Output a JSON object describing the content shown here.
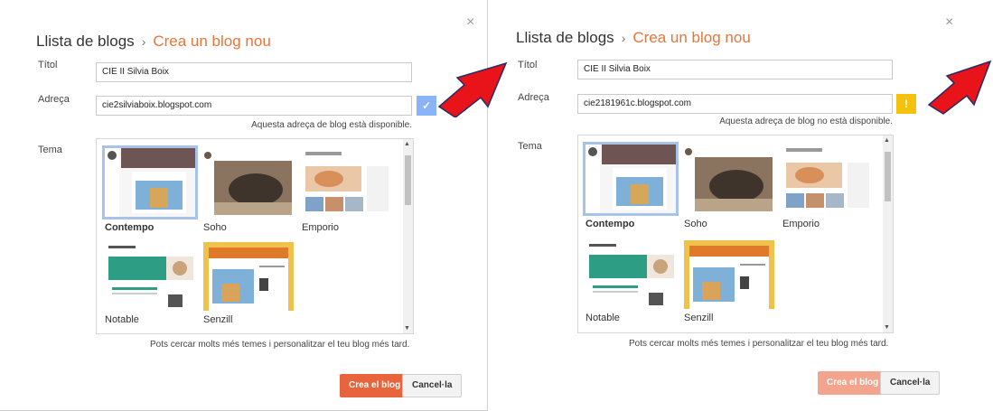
{
  "left": {
    "close_glyph": "×",
    "breadcrumb_root": "Llista de blogs",
    "breadcrumb_sep": "›",
    "breadcrumb_current": "Crea un blog nou",
    "title_label": "Títol",
    "title_value": "CIE II Silvia Boix",
    "address_label": "Adreça",
    "address_value": "cie2silviaboix.blogspot.com",
    "address_status_glyph": "✓",
    "availability": "Aquesta adreça de blog està disponible.",
    "theme_label": "Tema",
    "themes": [
      "Contempo",
      "Soho",
      "Emporio",
      "Notable",
      "Senzill"
    ],
    "selected_theme": "Contempo",
    "hint": "Pots cercar molts més temes i personalitzar el teu blog més tard.",
    "create_button": "Crea el blog",
    "cancel_button": "Cancel·la"
  },
  "right": {
    "close_glyph": "×",
    "breadcrumb_root": "Llista de blogs",
    "breadcrumb_sep": "›",
    "breadcrumb_current": "Crea un blog nou",
    "title_label": "Títol",
    "title_value": "CIE II Silvia Boix",
    "address_label": "Adreça",
    "address_value": "cie2181961c.blogspot.com",
    "address_status_glyph": "!",
    "availability": "Aquesta adreça de blog no està disponible.",
    "theme_label": "Tema",
    "themes": [
      "Contempo",
      "Soho",
      "Emporio",
      "Notable",
      "Senzill"
    ],
    "selected_theme": "Contempo",
    "hint": "Pots cercar molts més temes i personalitzar el teu blog més tard.",
    "create_button": "Crea el blog",
    "cancel_button": "Cancel·la"
  },
  "colors": {
    "accent": "#e8743b",
    "primary_button": "#e8643c",
    "ok_status": "#8ab4f8",
    "warn_status": "#f4c20d",
    "annotation_arrow": "#e8141a"
  }
}
